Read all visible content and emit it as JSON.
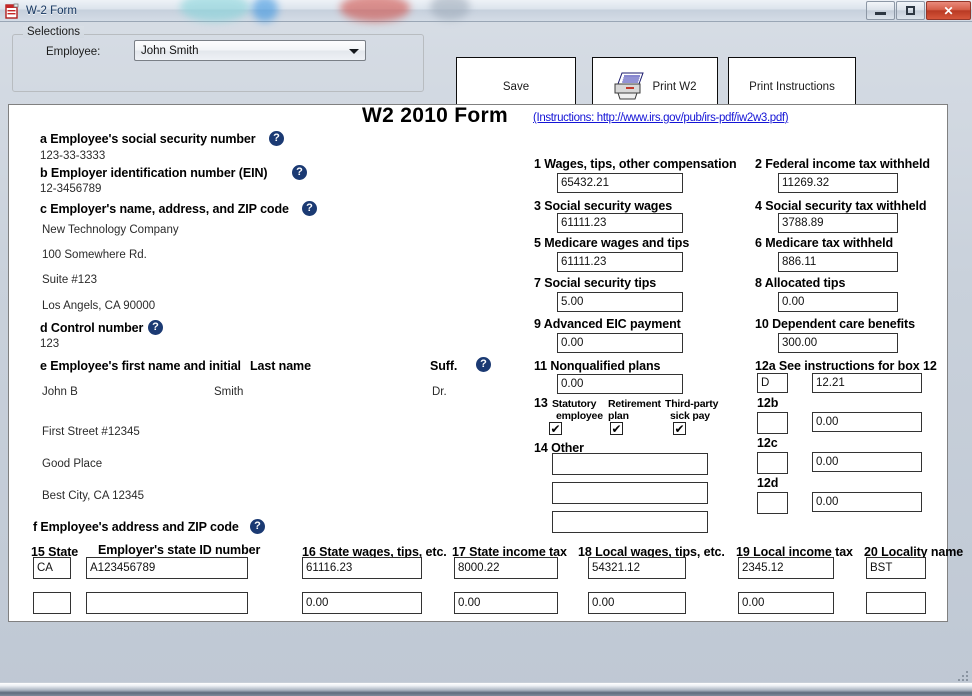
{
  "window": {
    "title": "W-2 Form",
    "icon": "w2-form-icon",
    "controls": {
      "minimize": "minimize-icon",
      "restore": "restore-icon",
      "close": "✕"
    }
  },
  "toolbar": {
    "selections_legend": "Selections",
    "employee_label": "Employee:",
    "employee_value": "John Smith",
    "employee_options": [
      "John Smith"
    ],
    "save_label": "Save",
    "print_w2_label": "Print W2",
    "print_instructions_label": "Print Instructions"
  },
  "form": {
    "title": "W2 2010 Form",
    "instructions_link": "(Instructions: http://www.irs.gov/pub/irs-pdf/iw2w3.pdf)",
    "help_glyph": "?",
    "check_glyph": "✔",
    "left": {
      "a_label": "a Employee's social security number",
      "a_value": "123-33-3333",
      "b_label": "b Employer identification number (EIN)",
      "b_value": "12-3456789",
      "c_label": "c Employer's name, address, and ZIP code",
      "c_line1": "New Technology Company",
      "c_line2": "100 Somewhere Rd.",
      "c_line3": "Suite #123",
      "c_line4": "Los Angels, CA 90000",
      "d_label": "d Control number",
      "d_value": "123",
      "e_label": "e Employee's first name and initial",
      "e_lastname_label": "Last name",
      "e_suffix_label": "Suff.",
      "e_firstname_value": "John B",
      "e_lastname_value": "Smith",
      "e_suffix_value": "Dr.",
      "e_addr1": "First Street #12345",
      "e_addr2": "Good Place",
      "e_addr3": "Best City, CA 12345",
      "f_label": "f Employee's address and ZIP code"
    },
    "boxes": {
      "b1_label": "1 Wages, tips, other compensation",
      "b1_value": "65432.21",
      "b2_label": "2 Federal income tax withheld",
      "b2_value": "11269.32",
      "b3_label": "3 Social security wages",
      "b3_value": "61111.23",
      "b4_label": "4 Social security tax withheld",
      "b4_value": "3788.89",
      "b5_label": "5 Medicare wages and tips",
      "b5_value": "61111.23",
      "b6_label": "6 Medicare tax withheld",
      "b6_value": "886.11",
      "b7_label": "7 Social security tips",
      "b7_value": "5.00",
      "b8_label": "8 Allocated tips",
      "b8_value": "0.00",
      "b9_label": "9 Advanced EIC payment",
      "b9_value": "0.00",
      "b10_label": "10 Dependent care benefits",
      "b10_value": "300.00",
      "b11_label": "11 Nonqualified plans",
      "b11_value": "0.00",
      "b13_num": "13",
      "b13_c1_line1": "Statutory",
      "b13_c1_line2": "employee",
      "b13_c2_line1": "Retirement",
      "b13_c2_line2": "plan",
      "b13_c3_line1": "Third-party",
      "b13_c3_line2": "sick pay",
      "b13_statutory_checked": true,
      "b13_retirement_checked": true,
      "b13_thirdparty_checked": true,
      "b14_label": "14 Other",
      "b14_row1": "",
      "b14_row2": "",
      "b14_row3": "",
      "b12a_label": "12a See instructions for box 12",
      "b12a_code": "D",
      "b12a_amount": "12.21",
      "b12b_label": "12b",
      "b12b_code": "",
      "b12b_amount": "0.00",
      "b12c_label": "12c",
      "b12c_code": "",
      "b12c_amount": "0.00",
      "b12d_label": "12d",
      "b12d_code": "",
      "b12d_amount": "0.00"
    },
    "state_table": {
      "headers": {
        "h15": "15 State",
        "h_stateid": "Employer's state ID number",
        "h16": "16 State wages, tips, etc.",
        "h17": "17 State income tax",
        "h18": "18 Local wages, tips, etc.",
        "h19": "19 Local income tax",
        "h20": "20 Locality name"
      },
      "rows": [
        {
          "state": "CA",
          "state_id": "A123456789",
          "state_wages": "61116.23",
          "state_income_tax": "8000.22",
          "local_wages": "54321.12",
          "local_income_tax": "2345.12",
          "locality_name": "BST"
        },
        {
          "state": "",
          "state_id": "",
          "state_wages": "0.00",
          "state_income_tax": "0.00",
          "local_wages": "0.00",
          "local_income_tax": "0.00",
          "locality_name": ""
        }
      ]
    }
  },
  "colors": {
    "help_badge": "#1b3a73",
    "link": "#1414d6",
    "close_button": "#b93a24",
    "panel_border": "#808080"
  }
}
